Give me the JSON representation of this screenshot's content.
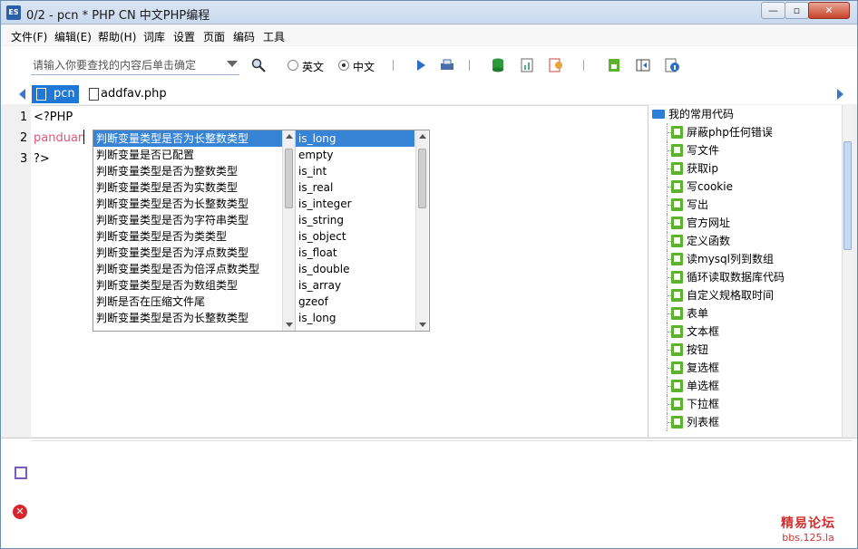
{
  "window": {
    "app_icon_text": "ES",
    "title": "0/2 - pcn * PHP CN 中文PHP编程",
    "controls": {
      "minimize": "—",
      "maximize": "▫",
      "close": "✕"
    }
  },
  "menubar": {
    "items": [
      "文件(F)",
      "编辑(E)",
      "帮助(H)",
      "词库",
      "设置",
      "页面",
      "编码",
      "工具"
    ]
  },
  "toolbar": {
    "search_placeholder": "请输入你要查找的内容后单击确定",
    "radio_en_label": "英文",
    "radio_cn_label": "中文",
    "selected_language": "中文"
  },
  "tabs": [
    {
      "label": "pcn",
      "active": true
    },
    {
      "label": "addfav.php",
      "active": false
    }
  ],
  "editor": {
    "lines": [
      {
        "num": "1",
        "text": "<?PHP"
      },
      {
        "num": "2",
        "text": "panduan"
      },
      {
        "num": "3",
        "text": "?>"
      }
    ]
  },
  "autocomplete": {
    "descriptions": [
      "判断变量类型是否为长整数类型",
      "判断变量是否已配置",
      "判断变量类型是否为整数类型",
      "判断变量类型是否为实数类型",
      "判断变量类型是否为长整数类型",
      "判断变量类型是否为字符串类型",
      "判断变量类型是否为类类型",
      "判断变量类型是否为浮点数类型",
      "判断变量类型是否为倍浮点数类型",
      "判断变量类型是否为数组类型",
      "判断是否在压缩文件尾",
      "判断变量类型是否为长整数类型"
    ],
    "functions": [
      "is_long",
      "empty",
      "is_int",
      "is_real",
      "is_integer",
      "is_string",
      "is_object",
      "is_float",
      "is_double",
      "is_array",
      "gzeof",
      "is_long"
    ],
    "selected_index": 0
  },
  "side_panel": {
    "header": "我的常用代码",
    "items": [
      "屏蔽php任何错误",
      "写文件",
      "获取ip",
      "写cookie",
      "写出",
      "官方网址",
      "定义函数",
      "读mysql列到数组",
      "循环读取数据库代码",
      "自定义规格取时间",
      "表单",
      "文本框",
      "按钮",
      "复选框",
      "单选框",
      "下拉框",
      "列表框"
    ]
  },
  "watermark": {
    "line1": "精易论坛",
    "line2": "bbs.125.la"
  }
}
